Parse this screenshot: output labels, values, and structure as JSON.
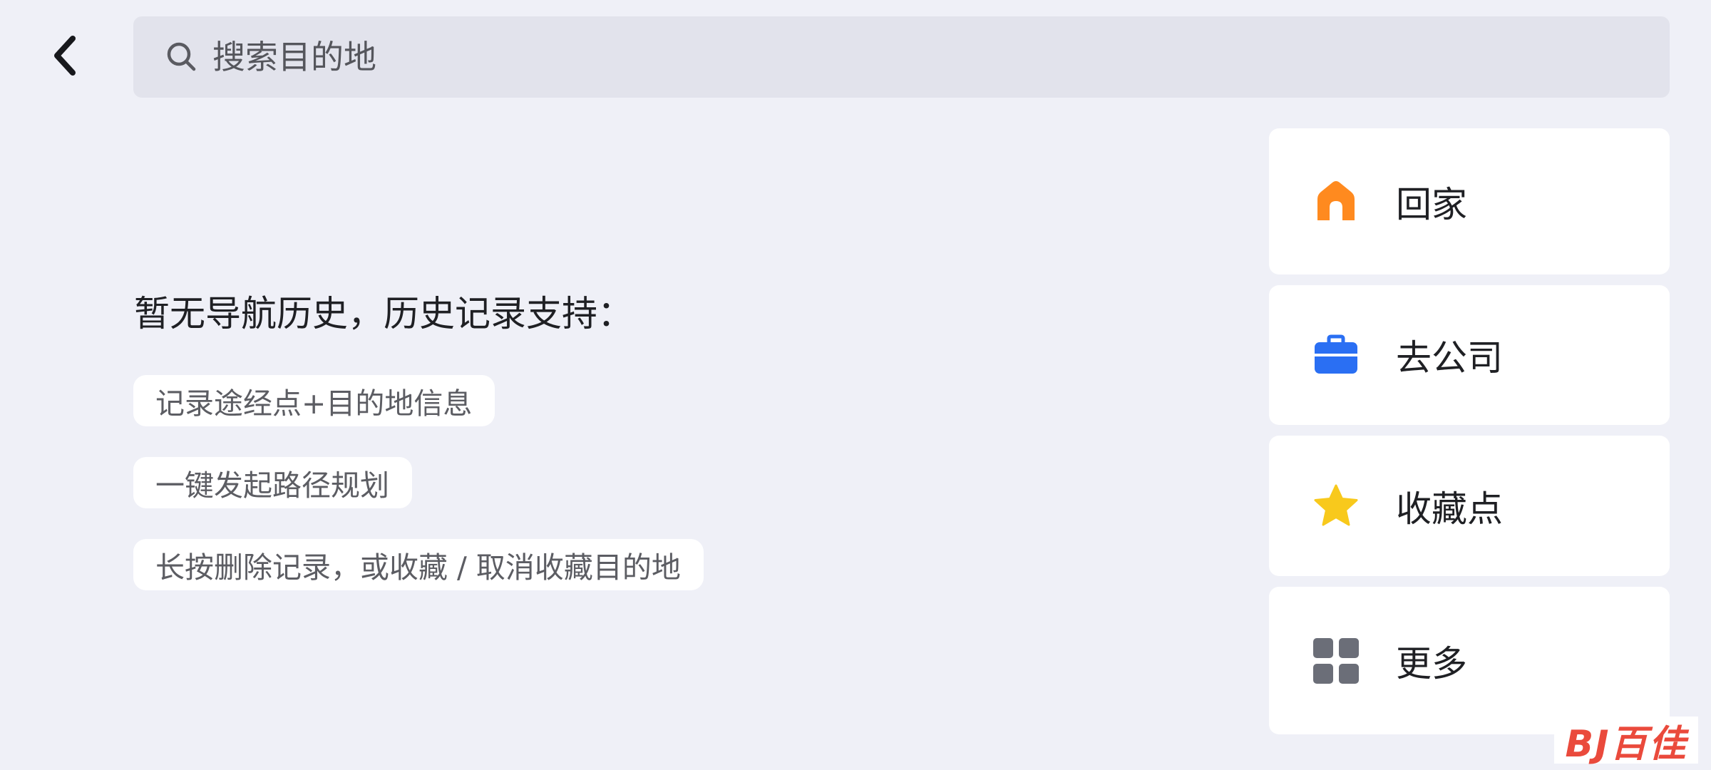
{
  "header": {
    "back_icon": "chevron-left-icon",
    "search": {
      "icon": "search-icon",
      "placeholder": "搜索目的地",
      "value": ""
    }
  },
  "history": {
    "empty_title": "暂无导航历史，历史记录支持：",
    "tips": [
      "记录途经点+目的地信息",
      "一键发起路径规划",
      "长按删除记录，或收藏 / 取消收藏目的地"
    ]
  },
  "quick_entries": [
    {
      "label": "回家",
      "icon": "home-icon",
      "color": "#ff8a1f"
    },
    {
      "label": "去公司",
      "icon": "briefcase-icon",
      "color": "#2a6ff3"
    },
    {
      "label": "收藏点",
      "icon": "star-icon",
      "color": "#f8c91c"
    },
    {
      "label": "更多",
      "icon": "grid-icon",
      "color": "#6b6e78"
    }
  ],
  "watermark": {
    "text": "BJ百佳",
    "color": "#ea4a3c"
  }
}
